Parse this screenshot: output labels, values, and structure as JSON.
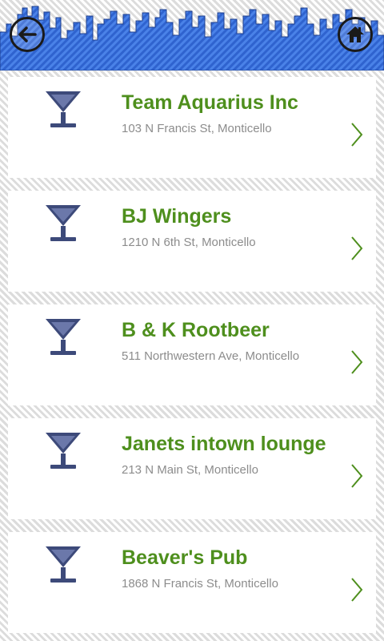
{
  "header": {
    "back_icon": "back-arrow-icon",
    "home_icon": "home-icon",
    "skyline_color": "#3b6fd6"
  },
  "venues": [
    {
      "name": "Team Aquarius Inc",
      "address": "103 N Francis St, Monticello"
    },
    {
      "name": "BJ Wingers",
      "address": "1210 N 6th St, Monticello"
    },
    {
      "name": "B & K Rootbeer",
      "address": "511 Northwestern Ave, Monticello"
    },
    {
      "name": "Janets intown lounge",
      "address": "213 N Main St, Monticello"
    },
    {
      "name": "Beaver's Pub",
      "address": "1868 N Francis St, Monticello"
    }
  ],
  "colors": {
    "title": "#4e8f1d",
    "address": "#8c8c8c",
    "glass": "#3d4a7a",
    "chevron": "#4e8f1d"
  }
}
